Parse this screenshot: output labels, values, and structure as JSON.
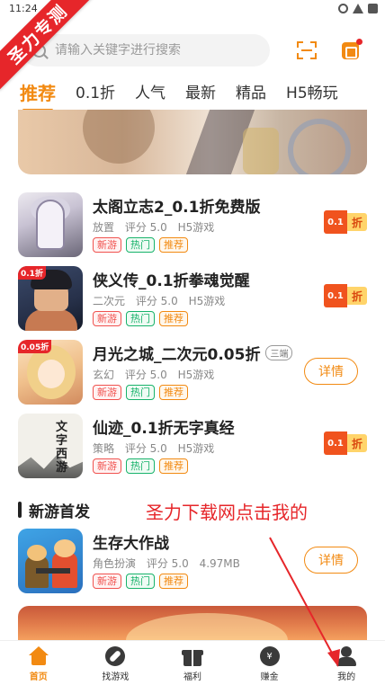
{
  "status_bar": {
    "time": "11:24"
  },
  "watermark": {
    "text": "圣力专测"
  },
  "search": {
    "placeholder": "请输入关键字进行搜索"
  },
  "tabs": [
    {
      "label": "推荐",
      "active": true
    },
    {
      "label": "0.1折",
      "active": false
    },
    {
      "label": "人气",
      "active": false
    },
    {
      "label": "最新",
      "active": false
    },
    {
      "label": "精品",
      "active": false
    },
    {
      "label": "H5畅玩",
      "active": false
    }
  ],
  "games": [
    {
      "title": "太阁立志2_0.1折免费版",
      "category": "放置",
      "rating": "评分 5.0",
      "type": "H5游戏",
      "tags": [
        "新游",
        "热门",
        "推荐"
      ],
      "discount": {
        "value": "0.1",
        "unit": "折"
      }
    },
    {
      "title": "侠义传_0.1折拳魂觉醒",
      "category": "二次元",
      "rating": "评分 5.0",
      "type": "H5游戏",
      "tags": [
        "新游",
        "热门",
        "推荐"
      ],
      "thumb_badge": "0.1折",
      "discount": {
        "value": "0.1",
        "unit": "折"
      }
    },
    {
      "title": "月光之城_二次元0.05折",
      "title_badge": "三端",
      "category": "玄幻",
      "rating": "评分 5.0",
      "type": "H5游戏",
      "tags": [
        "新游",
        "热门",
        "推荐"
      ],
      "thumb_badge": "0.05折",
      "action": "详情"
    },
    {
      "title": "仙迹_0.1折无字真经",
      "category": "策略",
      "rating": "评分 5.0",
      "type": "H5游戏",
      "tags": [
        "新游",
        "热门",
        "推荐"
      ],
      "thumb_text": "文字西游",
      "discount": {
        "value": "0.1",
        "unit": "折"
      }
    }
  ],
  "section": {
    "title": "新游首发",
    "promo_text": "圣力下载网点击我的"
  },
  "new_game": {
    "title": "生存大作战",
    "category": "角色扮演",
    "rating": "评分 5.0",
    "size": "4.97MB",
    "tags": [
      "新游",
      "热门",
      "推荐"
    ],
    "action": "详情"
  },
  "nav": [
    {
      "label": "首页",
      "icon": "home-icon",
      "active": true
    },
    {
      "label": "找游戏",
      "icon": "compass-icon",
      "active": false
    },
    {
      "label": "福利",
      "icon": "gift-icon",
      "active": false
    },
    {
      "label": "赚金",
      "icon": "money-icon",
      "active": false
    },
    {
      "label": "我的",
      "icon": "user-icon",
      "active": false
    }
  ],
  "colors": {
    "accent": "#f28a12",
    "promo_red": "#e6262a",
    "tag_new": "#f0524f",
    "tag_hot": "#18b36b",
    "tag_rec": "#f28a12"
  }
}
